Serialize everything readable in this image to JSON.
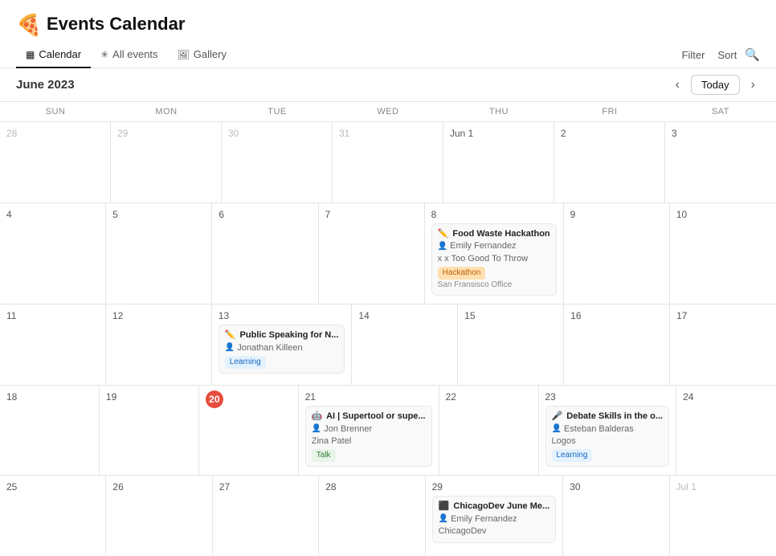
{
  "app": {
    "title": "Events Calendar",
    "logo_emoji": "🍕"
  },
  "nav": {
    "tabs": [
      {
        "id": "calendar",
        "label": "Calendar",
        "icon": "▦",
        "active": true
      },
      {
        "id": "all-events",
        "label": "All events",
        "icon": "✳",
        "active": false
      },
      {
        "id": "gallery",
        "label": "Gallery",
        "icon": "🖼",
        "active": false
      }
    ]
  },
  "toolbar": {
    "month_title": "June 2023",
    "filter_label": "Filter",
    "sort_label": "Sort",
    "today_label": "Today"
  },
  "calendar": {
    "day_headers": [
      "Sun",
      "Mon",
      "Tue",
      "Wed",
      "Thu",
      "Fri",
      "Sat"
    ],
    "weeks": [
      {
        "days": [
          {
            "number": "28",
            "other_month": true,
            "events": []
          },
          {
            "number": "29",
            "other_month": true,
            "events": []
          },
          {
            "number": "30",
            "other_month": true,
            "events": []
          },
          {
            "number": "31",
            "other_month": true,
            "events": []
          },
          {
            "number": "Jun 1",
            "other_month": false,
            "events": []
          },
          {
            "number": "2",
            "other_month": false,
            "events": []
          },
          {
            "number": "3",
            "other_month": false,
            "events": []
          }
        ]
      },
      {
        "days": [
          {
            "number": "4",
            "other_month": false,
            "events": []
          },
          {
            "number": "5",
            "other_month": false,
            "events": []
          },
          {
            "number": "6",
            "other_month": false,
            "events": []
          },
          {
            "number": "7",
            "other_month": false,
            "events": []
          },
          {
            "number": "8",
            "other_month": false,
            "events": [
              {
                "id": "evt1",
                "icon": "✏️",
                "title": "Food Waste Hackathon",
                "person": "Emily Fernandez",
                "org": "Too Good To Throw",
                "org_prefix": "x",
                "tag": "Hackathon",
                "tag_class": "tag-hackathon",
                "location": "San Fransisco Office"
              }
            ]
          },
          {
            "number": "9",
            "other_month": false,
            "events": []
          },
          {
            "number": "10",
            "other_month": false,
            "events": []
          }
        ]
      },
      {
        "days": [
          {
            "number": "11",
            "other_month": false,
            "events": []
          },
          {
            "number": "12",
            "other_month": false,
            "events": []
          },
          {
            "number": "13",
            "other_month": false,
            "events": [
              {
                "id": "evt2",
                "icon": "✏️",
                "title": "Public Speaking for N...",
                "person": "Jonathan Killeen",
                "tag": "Learning",
                "tag_class": "tag-learning"
              }
            ]
          },
          {
            "number": "14",
            "other_month": false,
            "events": []
          },
          {
            "number": "15",
            "other_month": false,
            "events": []
          },
          {
            "number": "16",
            "other_month": false,
            "events": []
          },
          {
            "number": "17",
            "other_month": false,
            "events": []
          }
        ]
      },
      {
        "days": [
          {
            "number": "18",
            "other_month": false,
            "events": []
          },
          {
            "number": "19",
            "other_month": false,
            "events": []
          },
          {
            "number": "20",
            "other_month": false,
            "today": true,
            "events": []
          },
          {
            "number": "21",
            "other_month": false,
            "events": [
              {
                "id": "evt3",
                "icon": "🤖",
                "title": "AI | Supertool or supe...",
                "person": "Jon Brenner",
                "org": "Zina Patel",
                "tag": "Talk",
                "tag_class": "tag-talk"
              }
            ]
          },
          {
            "number": "22",
            "other_month": false,
            "events": []
          },
          {
            "number": "23",
            "other_month": false,
            "events": [
              {
                "id": "evt4",
                "icon": "🎤",
                "title": "Debate Skills in the o...",
                "person": "Esteban Balderas",
                "org": "Logos",
                "tag": "Learning",
                "tag_class": "tag-learning"
              }
            ]
          },
          {
            "number": "24",
            "other_month": false,
            "events": []
          }
        ]
      },
      {
        "days": [
          {
            "number": "25",
            "other_month": false,
            "events": []
          },
          {
            "number": "26",
            "other_month": false,
            "events": []
          },
          {
            "number": "27",
            "other_month": false,
            "events": []
          },
          {
            "number": "28",
            "other_month": false,
            "events": []
          },
          {
            "number": "29",
            "other_month": false,
            "events": [
              {
                "id": "evt5",
                "icon": "⬛",
                "title": "ChicagoDev June Me...",
                "person": "Emily Fernandez",
                "org": "ChicagoDev"
              }
            ]
          },
          {
            "number": "30",
            "other_month": false,
            "events": []
          },
          {
            "number": "Jul 1",
            "other_month": true,
            "events": []
          }
        ]
      }
    ]
  }
}
